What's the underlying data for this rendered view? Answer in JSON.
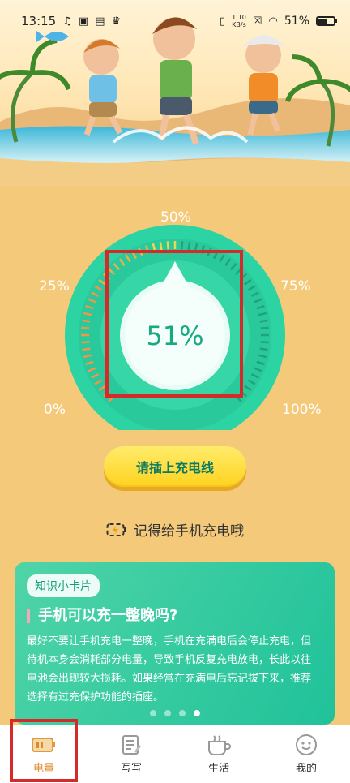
{
  "status_bar": {
    "time": "13:15",
    "network_speed_value": "1.10",
    "network_speed_unit": "KB/s",
    "battery_percent": "51%"
  },
  "gauge": {
    "label_0": "0%",
    "label_25": "25%",
    "label_50": "50%",
    "label_75": "75%",
    "label_100": "100%",
    "value": "51%",
    "level": 0.51
  },
  "actions": {
    "charge_button": "请插上充电线"
  },
  "reminder": {
    "text": "记得给手机充电哦"
  },
  "knowledge_card": {
    "tag": "知识小卡片",
    "title": "手机可以充一整晚吗?",
    "body": "最好不要让手机充电一整晚，手机在充满电后会停止充电，但待机本身会消耗部分电量，导致手机反复充电放电，长此以往电池会出现较大损耗。如果经常在充满电后忘记拔下来，推荐选择有过充保护功能的插座。"
  },
  "bottom_nav": {
    "items": [
      {
        "label": "电量",
        "icon": "battery-icon",
        "active": true
      },
      {
        "label": "写写",
        "icon": "notepad-icon",
        "active": false
      },
      {
        "label": "生活",
        "icon": "cup-icon",
        "active": false
      },
      {
        "label": "我的",
        "icon": "smile-face-icon",
        "active": false
      }
    ]
  },
  "colors": {
    "accent_green": "#2ccfa0",
    "background": "#f4c97a",
    "button_yellow": "#ffd21f"
  }
}
